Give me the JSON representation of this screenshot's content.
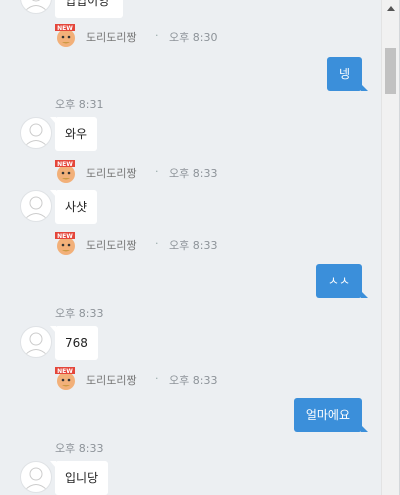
{
  "top_partial_message": "입입이잉",
  "reaction_name": "도리도리짱",
  "reaction_sep": "·",
  "messages": {
    "r1_time": "오후 8:30",
    "out1": "넹",
    "t1": "오후 8:31",
    "in1": "와우",
    "r2_time": "오후 8:33",
    "in2": "사샷",
    "r3_time": "오후 8:33",
    "out2": "ㅅㅅ",
    "t2": "오후 8:33",
    "in3": "768",
    "r4_time": "오후 8:33",
    "out3": "얼마에요",
    "t3": "오후 8:33",
    "in4": "입니당"
  },
  "emoji_badge": "NEW",
  "colors": {
    "accent": "#3b8fda",
    "background": "#eceff2"
  }
}
